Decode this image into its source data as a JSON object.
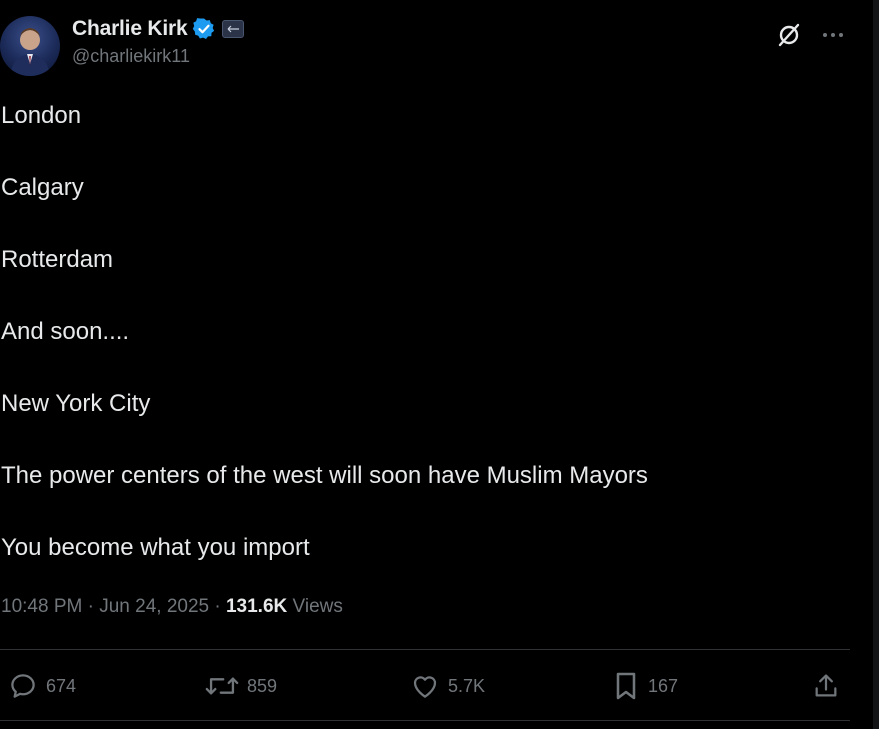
{
  "author": {
    "display_name": "Charlie Kirk",
    "handle": "@charliekirk11",
    "verified": true,
    "badge_color": "#1d9bf0"
  },
  "header_icons": {
    "grok": "grok-icon",
    "more": "more-icon"
  },
  "tweet": {
    "lines": [
      "London",
      "Calgary",
      "Rotterdam",
      "And soon....",
      "New York City",
      "The power centers of the west will soon have Muslim Mayors",
      "You become what you import"
    ]
  },
  "meta": {
    "time": "10:48 PM",
    "separator": " · ",
    "date": "Jun 24, 2025",
    "views_count": "131.6K",
    "views_label": " Views"
  },
  "actions": {
    "replies": "674",
    "reposts": "859",
    "likes": "5.7K",
    "bookmarks": "167"
  },
  "colors": {
    "background": "#000000",
    "text": "#e7e9ea",
    "muted": "#71767b",
    "divider": "#2f3336",
    "accent": "#1d9bf0"
  }
}
